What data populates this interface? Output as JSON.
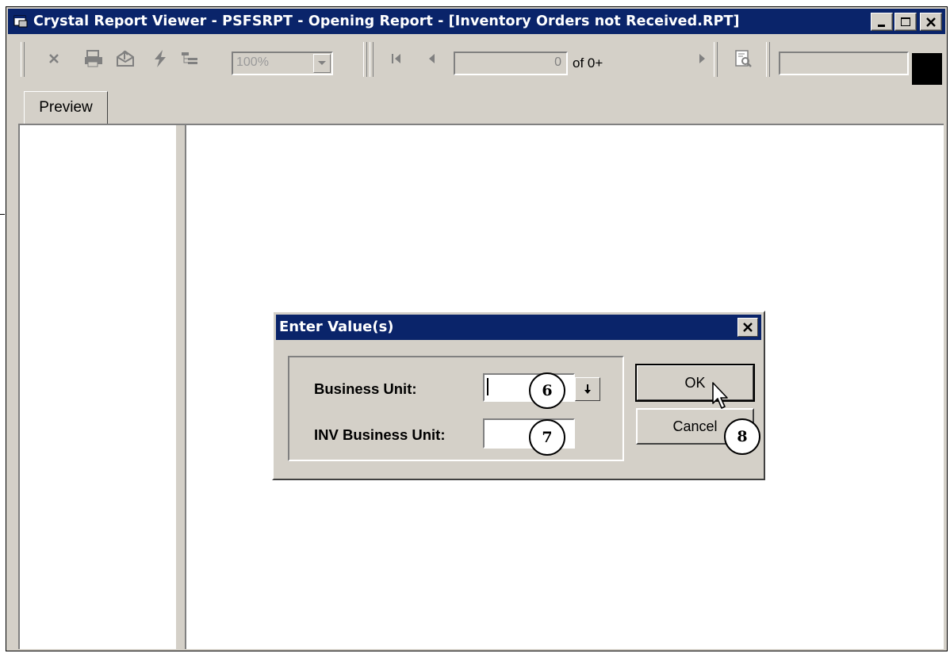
{
  "window": {
    "title": "Crystal Report Viewer - PSFSRPT - Opening Report - [Inventory Orders not Received.RPT]",
    "buttons": {
      "minimize": "minimize-icon",
      "maximize": "maximize-icon",
      "close": "close-icon"
    }
  },
  "toolbar": {
    "zoom_value": "100%",
    "page_current": "0",
    "page_of": "of 0+",
    "icons": [
      "close-report-icon",
      "print-icon",
      "export-icon",
      "refresh-icon",
      "group-tree-icon",
      "first-page-icon",
      "prev-page-icon",
      "next-page-icon",
      "search-text-icon"
    ]
  },
  "tabs": [
    {
      "label": "Preview"
    }
  ],
  "dialog": {
    "title": "Enter Value(s)",
    "fields": [
      {
        "label": "Business Unit:",
        "value": ""
      },
      {
        "label": "INV Business Unit:",
        "value": ""
      }
    ],
    "ok_label": "OK",
    "cancel_label": "Cancel"
  },
  "callouts": [
    "6",
    "7",
    "8"
  ],
  "colors": {
    "titlebar": "#0a246a",
    "face": "#d4d0c8"
  }
}
